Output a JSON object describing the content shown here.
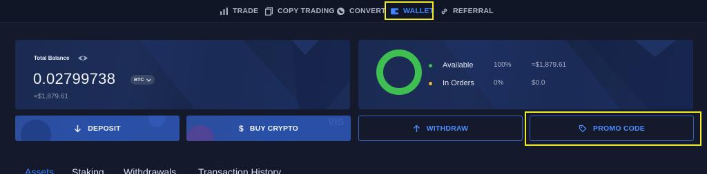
{
  "nav": {
    "items": [
      {
        "label": "TRADE",
        "icon": "bar-chart-icon"
      },
      {
        "label": "COPY TRADING",
        "icon": "copy-icon"
      },
      {
        "label": "CONVERT",
        "icon": "globe-icon"
      },
      {
        "label": "WALLET",
        "icon": "wallet-icon",
        "active": true
      },
      {
        "label": "REFERRAL",
        "icon": "link-icon"
      }
    ]
  },
  "balance": {
    "title": "Total Balance",
    "value": "0.02799738",
    "currency": "BTC",
    "fiat": "≈$1,879.61"
  },
  "summary": {
    "available": {
      "label": "Available",
      "percent": "100%",
      "amount": "≈$1,879.61",
      "color": "#3fbf52"
    },
    "in_orders": {
      "label": "In Orders",
      "percent": "0%",
      "amount": "$0.0",
      "color": "#e9b43a"
    }
  },
  "actions": {
    "deposit": "DEPOSIT",
    "buy_crypto": "BUY CRYPTO",
    "withdraw": "WITHDRAW",
    "promo_code": "PROMO CODE"
  },
  "tabs": [
    "Assets",
    "Staking",
    "Withdrawals",
    "Transaction History"
  ],
  "colors": {
    "accent": "#3f86ff",
    "highlight": "#f2ee22",
    "background": "#141a2c"
  }
}
